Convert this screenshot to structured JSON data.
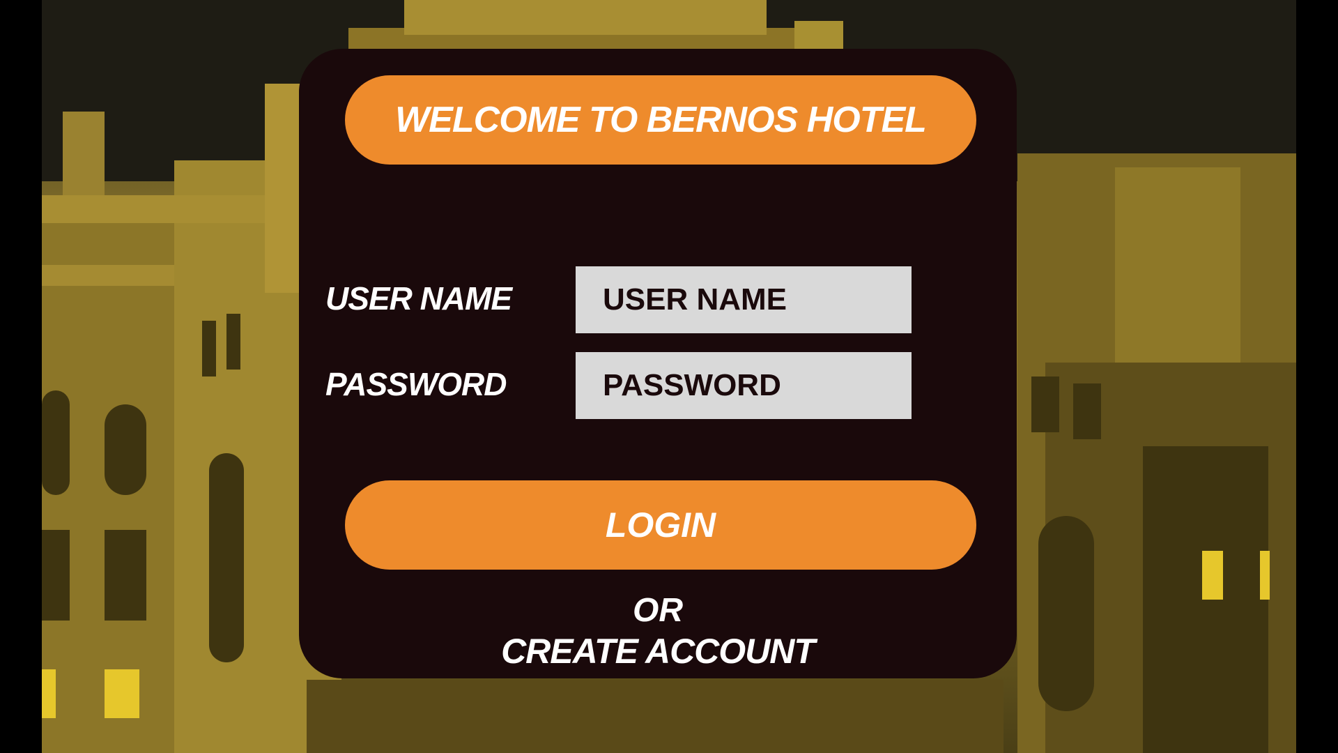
{
  "page": {
    "background_image": "hotel-building-illustration",
    "colors": {
      "accent": "#ee8b2c",
      "card": "#1a090b",
      "field": "#d9d9d9",
      "text": "#ffffff"
    }
  },
  "header": {
    "title": "WELCOME TO BERNOS HOTEL"
  },
  "form": {
    "username_label": "USER NAME",
    "username_placeholder": "USER NAME",
    "password_label": "PASSWORD",
    "password_placeholder": "PASSWORD",
    "login_label": "LOGIN",
    "or_text": "OR",
    "create_account_label": "CREATE ACCOUNT"
  }
}
